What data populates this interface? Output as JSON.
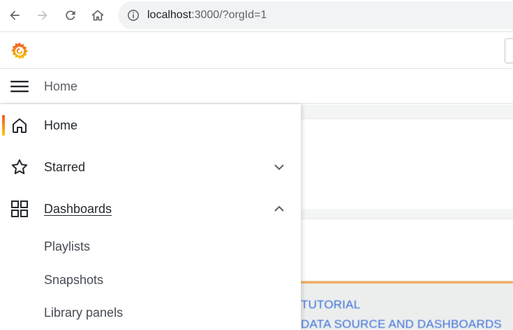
{
  "browser": {
    "url_host": "localhost",
    "url_rest": ":3000/?orgId=1"
  },
  "breadcrumb": {
    "label": "Home"
  },
  "menu": {
    "items": [
      {
        "label": "Home",
        "icon": "home-icon"
      },
      {
        "label": "Starred",
        "icon": "star-icon"
      },
      {
        "label": "Dashboards",
        "icon": "dashboards-grid-icon"
      }
    ],
    "sub_items": [
      "Playlists",
      "Snapshots",
      "Library panels"
    ]
  },
  "background": {
    "links": [
      "TUTORIAL",
      "DATA SOURCE AND DASHBOARDS"
    ]
  },
  "colors": {
    "accent_gradient_start": "#f05a28",
    "accent_gradient_end": "#fbca0a",
    "link": "#3d71d9"
  }
}
